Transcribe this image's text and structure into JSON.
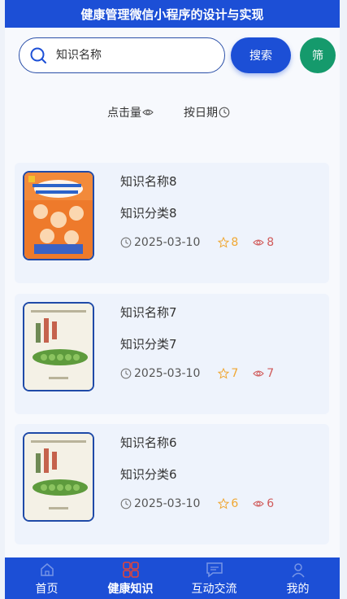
{
  "header": {
    "title": "健康管理微信小程序的设计与实现"
  },
  "search": {
    "placeholder": "知识名称",
    "value": "",
    "button_label": "搜索",
    "filter_label": "筛"
  },
  "sort": {
    "by_clicks": "点击量",
    "by_date": "按日期"
  },
  "items": [
    {
      "name": "知识名称8",
      "category": "知识分类8",
      "date": "2025-03-10",
      "stars": "8",
      "views": "8",
      "cover": "orange"
    },
    {
      "name": "知识名称7",
      "category": "知识分类7",
      "date": "2025-03-10",
      "stars": "7",
      "views": "7",
      "cover": "pea"
    },
    {
      "name": "知识名称6",
      "category": "知识分类6",
      "date": "2025-03-10",
      "stars": "6",
      "views": "6",
      "cover": "pea"
    }
  ],
  "tabbar": {
    "tabs": [
      {
        "label": "首页",
        "icon": "home-icon",
        "active": false
      },
      {
        "label": "健康知识",
        "icon": "health-knowledge-icon",
        "active": true
      },
      {
        "label": "互动交流",
        "icon": "chat-icon",
        "active": false
      },
      {
        "label": "我的",
        "icon": "user-icon",
        "active": false
      }
    ]
  },
  "colors": {
    "primary": "#1c4fd6",
    "filter": "#159a6c",
    "star": "#f0a732",
    "views": "#d05a5a"
  }
}
